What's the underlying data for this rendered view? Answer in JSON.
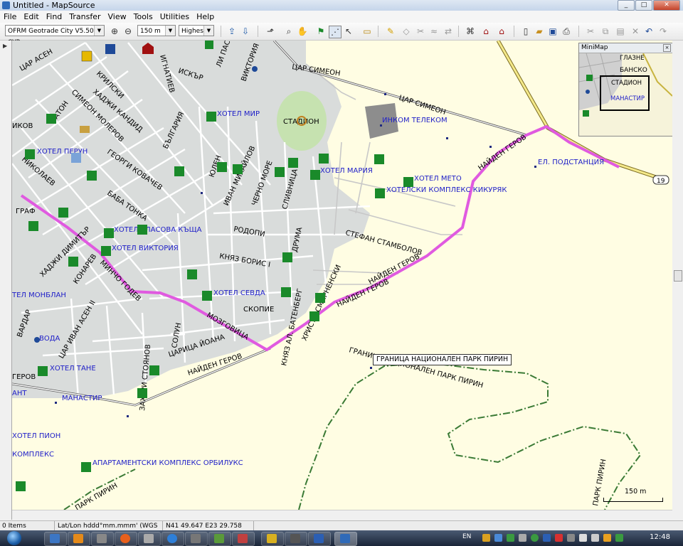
{
  "window": {
    "title": "Untitled - MapSource",
    "buttons": [
      "_",
      "□",
      "✕"
    ]
  },
  "menu": [
    "File",
    "Edit",
    "Find",
    "Transfer",
    "View",
    "Tools",
    "Utilities",
    "Help"
  ],
  "toolbar": {
    "map_product": "OFRM Geotrade City V5.50 CYR",
    "zoom_scale": "150 m",
    "detail_level": "Highest"
  },
  "minimap": {
    "title": "MiniMap",
    "labels": [
      "БАНСКО",
      "ГЛАЗНЕ",
      "СТАДИОН",
      "МАНАСТИР"
    ]
  },
  "map": {
    "tooltip": "ГРАНИЦА НАЦИОНАЛЕН ПАРК ПИРИН",
    "scale_label": "150 m",
    "road_shield": "19",
    "streets": [
      "ЦАР АСЕН",
      "ЦАР СИМЕОН",
      "ЦАР СИМЕОН",
      "ЦАР СИМЕОН",
      "ИСКЪР",
      "ДИМИТЪР",
      "ЛИ ПАСТ",
      "ВИКТОРИЯ",
      "ХАДЖИ КАНДИД",
      "СИМЕОН МОЛЕРОВ",
      "ГЕОРГИ КОВАЧЕВ",
      "БАБА ТОНКА",
      "БЪЛГАРИЯ",
      "ЮЛЕН",
      "ИВАН МИХАЙЛОВ",
      "ЧЕРНО МОРЕ",
      "СЛИВНИЦА",
      "РОДОПИ",
      "ДРУМА",
      "СТЕФАН СТАМБОЛОВ",
      "КНЯЗ БОРИС I",
      "МОЗГОВИЦА",
      "СКОПИЕ",
      "НАЙДЕН ГЕРОВ",
      "НАЙДЕН ГЕРОВ",
      "НАЙДЕН ГЕРОВ",
      "НАЙДЕН ГЕРОВ",
      "ХРИСТО СМИРНЕНСКИ",
      "КНЯЗ АЛ. БАТЕНБЕРГ",
      "ЦАРИЦА ЙОАНА",
      "ЗАХАРИ СТОЯНОВ",
      "СОЛУН",
      "ХАДЖИ ДИМИТЪР",
      "КОНАРЕВ",
      "МИНЧО ГОДЕВ",
      "ЦАР ИВАН АСЕН II",
      "ВАРДАР",
      "ГРАНИЦА НАЦИОНАЛЕН ПАРК ПИРИН",
      "ПАРК ПИРИН",
      "ПАРК ПИРИН",
      "ГРАФ",
      "ИГНАТИЕВ",
      "КРИЛСКИ",
      "НИКОЛАЕВ",
      "АТОН",
      "ИКОВ"
    ],
    "pois": [
      "СТАДИОН",
      "ИНКОМ ТЕЛЕКОМ",
      "ЕЛ. ПОДСТАНЦИЯ",
      "ХОТЕЛ МИР",
      "ХОТЕЛ ПЕРУН",
      "ХОТЕЛ МАРИЯ",
      "ХОТЕЛ МЕТО",
      "ХОТЕЛСКИ КОМПЛЕКС КИКУРЯК",
      "ХОТЕЛ ЕЛАСОВА КЪЩА",
      "ХОТЕЛ ВИКТОРИЯ",
      "ХОТЕЛ СЕВДА",
      "ТЕЛ МОНБЛАН",
      "ВОДА",
      "ХОТЕЛ ТАНЕ",
      "МАНАСТИР",
      "ХОТЕЛ ПИОН",
      "КОМПЛЕКС",
      "АПАРТАМЕНТСКИ КОМПЛЕКС ОРБИЛУКС",
      "ГЕРОВ",
      "АНТ"
    ]
  },
  "status": {
    "selection": "0 Items Selected",
    "position_format": "Lat/Lon hddd°mm.mmm' (WGS 84)",
    "coordinates": "N41 49.647 E23 29.758"
  },
  "taskbar": {
    "language": "EN",
    "clock": "12:48"
  },
  "colors": {
    "map_background": "#fffde3",
    "city_area": "#d9dcdb",
    "route": "#e05ae0",
    "park_border": "#3a7a35",
    "hotel_icon": "#1a8a2a",
    "poi_label": "#2020c8"
  }
}
